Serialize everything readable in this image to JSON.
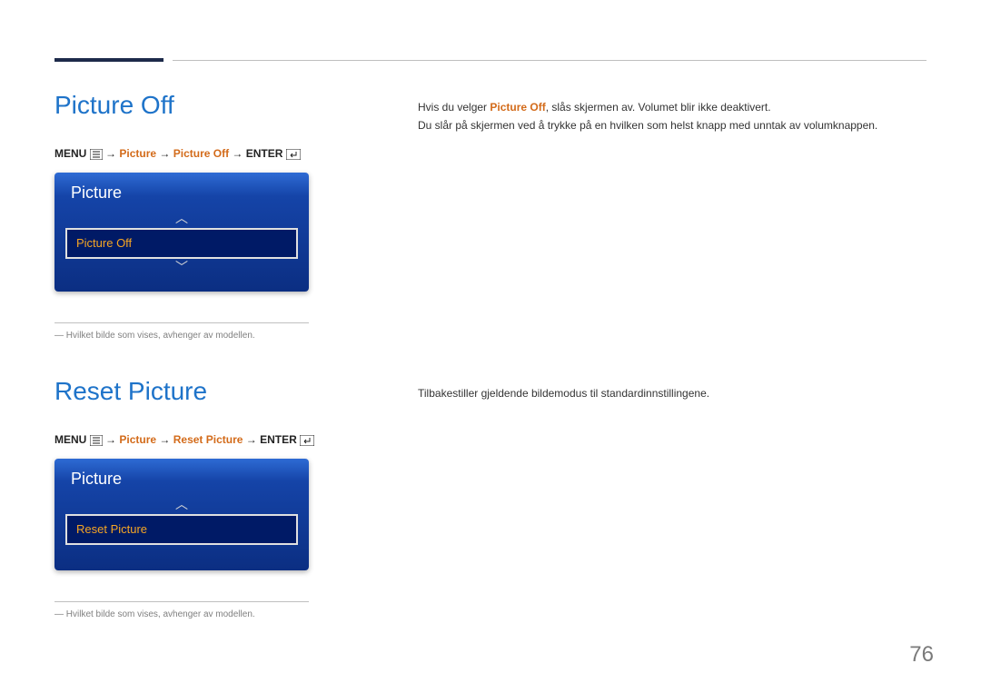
{
  "page_number": "76",
  "section1": {
    "title": "Picture Off",
    "breadcrumb": {
      "p1": "MENU ",
      "p2": " → ",
      "h1": "Picture",
      "p3": " → ",
      "h2": "Picture Off",
      "p4": " → ",
      "p5": "ENTER "
    },
    "panel_title": "Picture",
    "selected_label": "Picture Off",
    "footnote": "― Hvilket bilde som vises, avhenger av modellen.",
    "body_pre": "Hvis du velger ",
    "body_highlight": "Picture Off",
    "body_post": ", slås skjermen av. Volumet blir ikke deaktivert.",
    "body_line2": "Du slår på skjermen ved å trykke på en hvilken som helst knapp med unntak av volumknappen."
  },
  "section2": {
    "title": "Reset Picture",
    "breadcrumb": {
      "p1": "MENU ",
      "p2": " → ",
      "h1": "Picture",
      "p3": " → ",
      "h2": "Reset Picture",
      "p4": " → ",
      "p5": "ENTER "
    },
    "panel_title": "Picture",
    "selected_label": "Reset Picture",
    "footnote": "― Hvilket bilde som vises, avhenger av modellen.",
    "body": "Tilbakestiller gjeldende bildemodus til standardinnstillingene."
  }
}
